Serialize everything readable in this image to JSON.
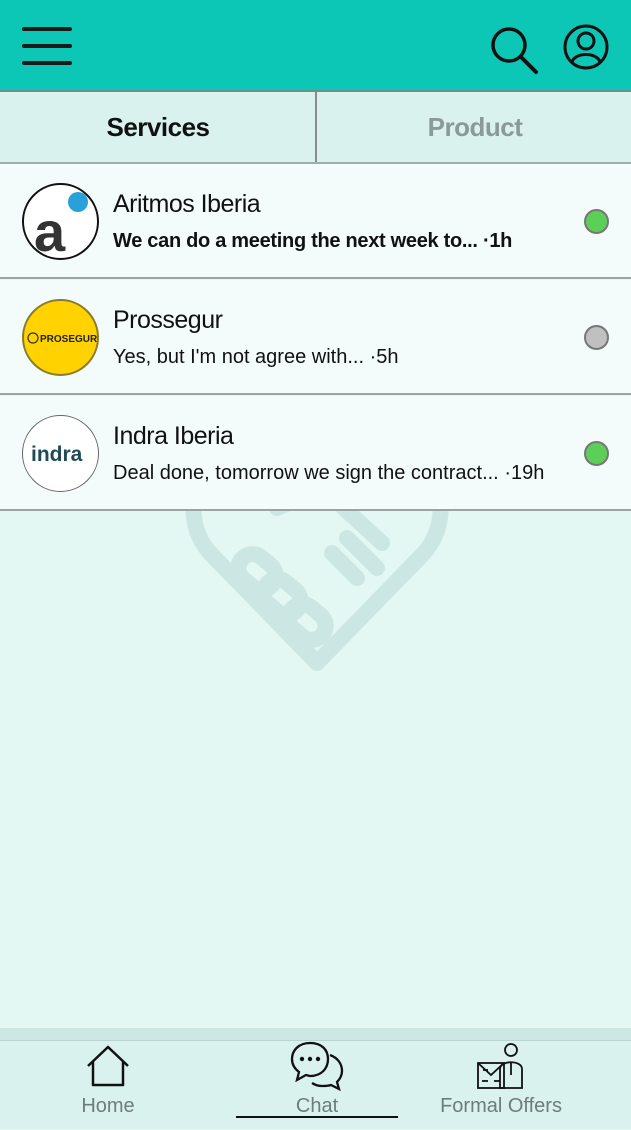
{
  "header": {
    "menu_icon": "hamburger-menu-icon",
    "search_icon": "search-icon",
    "profile_icon": "user-profile-icon",
    "bg_color": "#0cc7b6"
  },
  "tabs": [
    {
      "label": "Services",
      "active": true
    },
    {
      "label": "Product",
      "active": false
    }
  ],
  "watermark_icon": "handshake-heart-icon",
  "chats": [
    {
      "name": "Aritmos Iberia",
      "avatar_letter": "a",
      "message": "We can do a meeting the next week to...",
      "time": "·1h",
      "unread": true,
      "status_color": "#5ccf57"
    },
    {
      "name": "Prossegur",
      "avatar_text": "PROSEGUR",
      "message": "Yes, but I'm not agree with...",
      "time": "·5h",
      "unread": false,
      "status_color": "#c0c0c0"
    },
    {
      "name": "Indra Iberia",
      "avatar_text": "indra",
      "message": "Deal done, tomorrow we sign the contract...",
      "time": "·19h",
      "unread": false,
      "status_color": "#5ccf57"
    }
  ],
  "bottom_nav": [
    {
      "label": "Home",
      "icon": "home-icon",
      "active": false
    },
    {
      "label": "Chat",
      "icon": "chat-bubbles-icon",
      "active": true
    },
    {
      "label": "Formal Offers",
      "icon": "formal-offers-icon",
      "active": false
    }
  ]
}
